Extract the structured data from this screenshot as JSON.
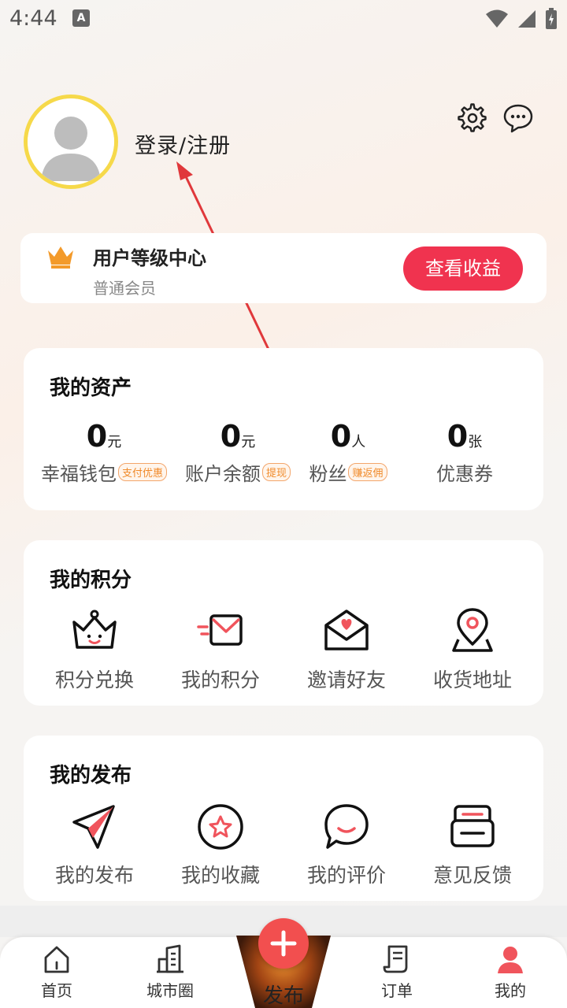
{
  "status": {
    "time": "4:44",
    "badge": "A"
  },
  "profile": {
    "login_label": "登录/注册"
  },
  "level": {
    "title": "用户等级中心",
    "subtitle": "普通会员",
    "button": "查看收益"
  },
  "assets": {
    "title": "我的资产",
    "items": [
      {
        "value": "0",
        "unit": "元",
        "label": "幸福钱包",
        "tag": "支付优惠"
      },
      {
        "value": "0",
        "unit": "元",
        "label": "账户余额",
        "tag": "提现"
      },
      {
        "value": "0",
        "unit": "人",
        "label": "粉丝",
        "tag": "赚返佣"
      },
      {
        "value": "0",
        "unit": "张",
        "label": "优惠券",
        "tag": ""
      }
    ]
  },
  "points": {
    "title": "我的积分",
    "items": [
      {
        "label": "积分兑换",
        "icon": "crown-face-icon"
      },
      {
        "label": "我的积分",
        "icon": "fast-mail-icon"
      },
      {
        "label": "邀请好友",
        "icon": "heart-envelope-icon"
      },
      {
        "label": "收货地址",
        "icon": "location-pin-icon"
      }
    ]
  },
  "publish": {
    "title": "我的发布",
    "items": [
      {
        "label": "我的发布",
        "icon": "paper-plane-icon"
      },
      {
        "label": "我的收藏",
        "icon": "star-circle-icon"
      },
      {
        "label": "我的评价",
        "icon": "chat-smile-icon"
      },
      {
        "label": "意见反馈",
        "icon": "feedback-box-icon"
      }
    ]
  },
  "tabbar": {
    "items": [
      {
        "label": "首页",
        "icon": "home-icon"
      },
      {
        "label": "城市圈",
        "icon": "city-icon"
      },
      {
        "label": "发布",
        "icon": "plus-icon"
      },
      {
        "label": "订单",
        "icon": "order-icon"
      },
      {
        "label": "我的",
        "icon": "user-icon"
      }
    ]
  },
  "colors": {
    "accent": "#f0334f",
    "avatar_ring": "#f6d94a",
    "crown": "#f39a2a",
    "icon_red": "#f0545c"
  }
}
